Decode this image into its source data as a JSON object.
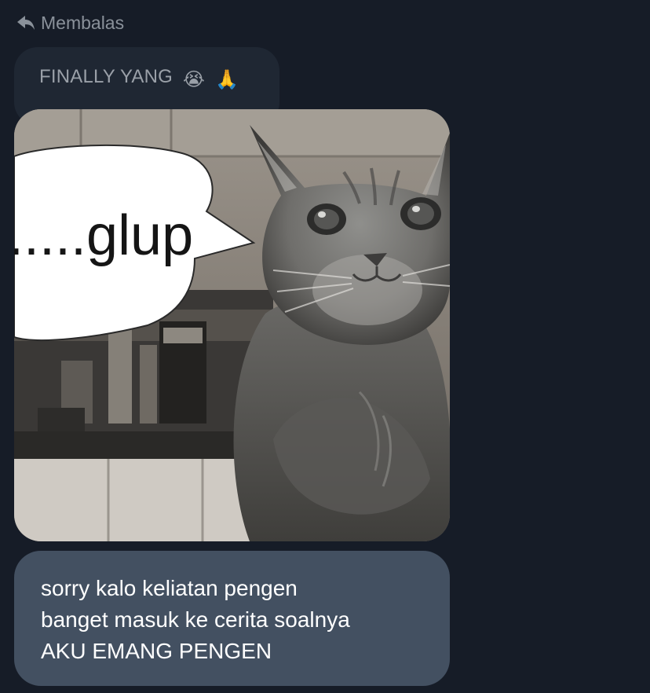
{
  "reply_header": {
    "label": "Membalas",
    "icon": "reply-arrow-icon"
  },
  "quoted_message": {
    "text": "FINALLY YANG",
    "emojis": [
      "😭",
      "🙏"
    ]
  },
  "image_message": {
    "caption_text": ".....glup",
    "description_icon": "cat-meme-image"
  },
  "message": {
    "lines": [
      "sorry kalo keliatan pengen",
      "banget masuk ke cerita soalnya",
      "AKU EMANG PENGEN"
    ]
  },
  "colors": {
    "background": "#161c27",
    "quoted_bubble": "#1f2733",
    "message_bubble": "#435061",
    "muted_text": "#8a919a"
  }
}
